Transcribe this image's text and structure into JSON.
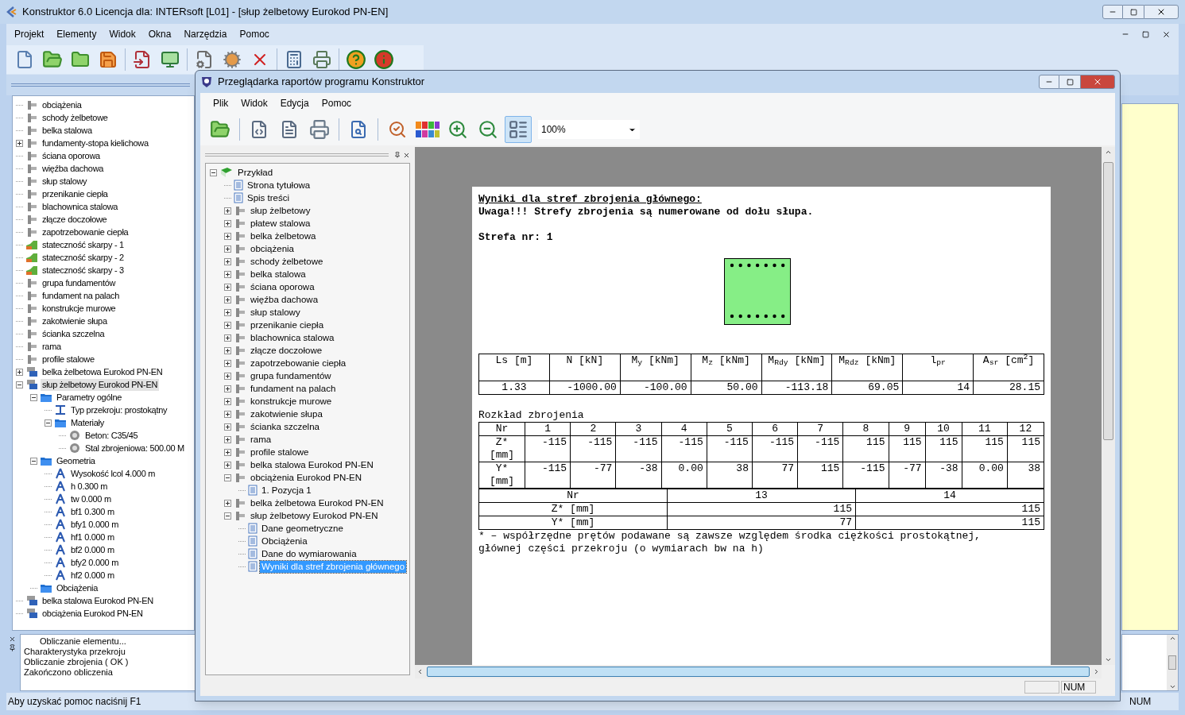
{
  "window": {
    "title": "Konstruktor 6.0 Licencja dla: INTERsoft [L01] - [słup żelbetowy Eurokod PN-EN]"
  },
  "menu": [
    "Projekt",
    "Elementy",
    "Widok",
    "Okna",
    "Narzędzia",
    "Pomoc"
  ],
  "element_tree": {
    "items": [
      {
        "label": "obciążenia",
        "kind": "element",
        "selected": false
      },
      {
        "label": "schody żelbetowe",
        "kind": "element",
        "selected": false
      },
      {
        "label": "belka stalowa",
        "kind": "element",
        "selected": false
      },
      {
        "label": "fundamenty-stopa kielichowa",
        "kind": "element",
        "selected": false,
        "expanded": false
      },
      {
        "label": "ściana oporowa",
        "kind": "element",
        "selected": false
      },
      {
        "label": "więźba dachowa",
        "kind": "element",
        "selected": false
      },
      {
        "label": "słup stalowy",
        "kind": "element",
        "selected": false
      },
      {
        "label": "przenikanie ciepła",
        "kind": "element",
        "selected": false
      },
      {
        "label": "blachownica stalowa",
        "kind": "element",
        "selected": false
      },
      {
        "label": "złącze doczołowe",
        "kind": "element",
        "selected": false
      },
      {
        "label": "zapotrzebowanie ciepła",
        "kind": "element",
        "selected": false
      },
      {
        "label": "stateczność skarpy - 1",
        "kind": "slope",
        "selected": false
      },
      {
        "label": "stateczność skarpy - 2",
        "kind": "slope",
        "selected": false
      },
      {
        "label": "stateczność skarpy - 3",
        "kind": "slope",
        "selected": false
      },
      {
        "label": "grupa fundamentów",
        "kind": "element",
        "selected": false
      },
      {
        "label": "fundament na palach",
        "kind": "element",
        "selected": false
      },
      {
        "label": "konstrukcje murowe",
        "kind": "element",
        "selected": false
      },
      {
        "label": "zakotwienie słupa",
        "kind": "element",
        "selected": false
      },
      {
        "label": "ścianka szczelna",
        "kind": "element",
        "selected": false
      },
      {
        "label": "rama",
        "kind": "element",
        "selected": false
      },
      {
        "label": "profile stalowe",
        "kind": "element",
        "selected": false
      },
      {
        "label": "belka żelbetowa Eurokod PN-EN",
        "kind": "eurocode",
        "selected": false,
        "expanded": false
      },
      {
        "label": "słup żelbetowy Eurokod PN-EN",
        "kind": "eurocode",
        "selected": true,
        "expanded": true,
        "children": [
          {
            "label": "Parametry ogólne",
            "kind": "folder",
            "selected": false,
            "expanded": true,
            "children": [
              {
                "label": "Typ przekroju: prostokątny",
                "kind": "section",
                "selected": false
              },
              {
                "label": "Materiały",
                "kind": "folder",
                "selected": false,
                "expanded": true,
                "children": [
                  {
                    "label": "Beton: C35/45",
                    "kind": "material",
                    "selected": false
                  },
                  {
                    "label": "Stal zbrojeniowa: 500.00 M",
                    "kind": "material",
                    "selected": false
                  }
                ]
              }
            ]
          },
          {
            "label": "Geometria",
            "kind": "folder",
            "selected": false,
            "expanded": true,
            "children": [
              {
                "label": "Wysokość lcol 4.000 m",
                "kind": "dimension",
                "selected": false
              },
              {
                "label": "h 0.300 m",
                "kind": "dimension",
                "selected": false
              },
              {
                "label": "tw 0.000 m",
                "kind": "dimension",
                "selected": false
              },
              {
                "label": "bf1 0.300 m",
                "kind": "dimension",
                "selected": false
              },
              {
                "label": "bfy1 0.000 m",
                "kind": "dimension",
                "selected": false
              },
              {
                "label": "hf1 0.000 m",
                "kind": "dimension",
                "selected": false
              },
              {
                "label": "bf2 0.000 m",
                "kind": "dimension",
                "selected": false
              },
              {
                "label": "bfy2 0.000 m",
                "kind": "dimension",
                "selected": false
              },
              {
                "label": "hf2 0.000 m",
                "kind": "dimension",
                "selected": false
              }
            ]
          },
          {
            "label": "Obciążenia",
            "kind": "folder",
            "selected": false
          }
        ]
      },
      {
        "label": "belka stalowa Eurokod PN-EN",
        "kind": "eurocode",
        "selected": false
      },
      {
        "label": "obciążenia Eurokod PN-EN",
        "kind": "eurocode",
        "selected": false
      }
    ]
  },
  "output": {
    "lines": [
      {
        "text": "Obliczanie elementu...",
        "kind": "title"
      },
      {
        "text": "Charakterystyka przekroju",
        "kind": "line"
      },
      {
        "text": "Obliczanie zbrojenia ( OK )",
        "kind": "line"
      },
      {
        "text": "Zakończono obliczenia",
        "kind": "line"
      }
    ]
  },
  "status_bar": {
    "message": "Aby uzyskać pomoc naciśnij F1",
    "indicator": "NUM"
  },
  "report_viewer": {
    "title": "Przeglądarka raportów programu Konstruktor",
    "menu": [
      "Plik",
      "Widok",
      "Edycja",
      "Pomoc"
    ],
    "toolbar": {
      "page_view": {
        "on": true
      },
      "zoom": "100%"
    },
    "tree": [
      {
        "label": "Przykład",
        "kind": "project",
        "selected": false,
        "expanded": true,
        "children": [
          {
            "label": "Strona tytułowa",
            "kind": "page",
            "selected": false
          },
          {
            "label": "Spis treści",
            "kind": "page",
            "selected": false
          },
          {
            "label": "słup żelbetowy",
            "kind": "element",
            "selected": false,
            "expanded": false
          },
          {
            "label": "płatew stalowa",
            "kind": "element",
            "selected": false,
            "expanded": false
          },
          {
            "label": "belka żelbetowa",
            "kind": "element",
            "selected": false,
            "expanded": false
          },
          {
            "label": "obciążenia",
            "kind": "element",
            "selected": false,
            "expanded": false
          },
          {
            "label": "schody żelbetowe",
            "kind": "element",
            "selected": false,
            "expanded": false
          },
          {
            "label": "belka stalowa",
            "kind": "element",
            "selected": false,
            "expanded": false
          },
          {
            "label": "ściana oporowa",
            "kind": "element",
            "selected": false,
            "expanded": false
          },
          {
            "label": "więźba dachowa",
            "kind": "element",
            "selected": false,
            "expanded": false
          },
          {
            "label": "słup stalowy",
            "kind": "element",
            "selected": false,
            "expanded": false
          },
          {
            "label": "przenikanie ciepła",
            "kind": "element",
            "selected": false,
            "expanded": false
          },
          {
            "label": "blachownica stalowa",
            "kind": "element",
            "selected": false,
            "expanded": false
          },
          {
            "label": "złącze doczołowe",
            "kind": "element",
            "selected": false,
            "expanded": false
          },
          {
            "label": "zapotrzebowanie ciepła",
            "kind": "element",
            "selected": false,
            "expanded": false
          },
          {
            "label": "grupa fundamentów",
            "kind": "element",
            "selected": false,
            "expanded": false
          },
          {
            "label": "fundament na palach",
            "kind": "element",
            "selected": false,
            "expanded": false
          },
          {
            "label": "konstrukcje murowe",
            "kind": "element",
            "selected": false,
            "expanded": false
          },
          {
            "label": "zakotwienie słupa",
            "kind": "element",
            "selected": false,
            "expanded": false
          },
          {
            "label": "ścianka szczelna",
            "kind": "element",
            "selected": false,
            "expanded": false
          },
          {
            "label": "rama",
            "kind": "element",
            "selected": false,
            "expanded": false
          },
          {
            "label": "profile stalowe",
            "kind": "element",
            "selected": false,
            "expanded": false
          },
          {
            "label": "belka stalowa Eurokod PN-EN",
            "kind": "element",
            "selected": false,
            "expanded": false
          },
          {
            "label": "obciążenia Eurokod PN-EN",
            "kind": "element",
            "selected": false,
            "expanded": true,
            "children": [
              {
                "label": "1. Pozycja 1",
                "kind": "page",
                "selected": false
              }
            ]
          },
          {
            "label": "belka żelbetowa Eurokod PN-EN",
            "kind": "element",
            "selected": false,
            "expanded": false
          },
          {
            "label": "słup żelbetowy Eurokod PN-EN",
            "kind": "element",
            "selected": false,
            "expanded": true,
            "children": [
              {
                "label": "Dane geometryczne",
                "kind": "page",
                "selected": false
              },
              {
                "label": "Obciążenia",
                "kind": "page",
                "selected": false
              },
              {
                "label": "Dane do wymiarowania",
                "kind": "page",
                "selected": false
              },
              {
                "label": "Wyniki dla stref zbrojenia głównego",
                "kind": "page",
                "selected": true
              }
            ]
          }
        ]
      }
    ],
    "report": {
      "heading": "Wyniki dla stref zbrojenia głównego:",
      "note": "Uwaga!!! Strefy zbrojenia są numerowane od dołu słupa.",
      "zone": "Strefa nr: 1",
      "results_table": {
        "columns": [
          "Ls [m]",
          "N [kN]",
          "M$_{y}$ [kNm]",
          "M$_{z}$ [kNm]",
          "M$_{Rdy}$ [kNm]",
          "M$_{Rdz}$ [kNm]",
          "l$_{pr}$",
          "A$_{sr}$ [cm$^{2}$]"
        ],
        "rows": [
          [
            "1.33",
            "-1000.00",
            "-100.00",
            "50.00",
            "-113.18",
            "69.05",
            "14",
            "28.15"
          ]
        ]
      },
      "distribution_title": "Rozkład zbrojenia",
      "distribution_table": {
        "columns": [
          "Nr",
          "1",
          "2",
          "3",
          "4",
          "5",
          "6",
          "7",
          "8",
          "9",
          "10",
          "11",
          "12"
        ],
        "rows": [
          {
            "label": "Z* [mm]",
            "values": [
              "-115",
              "-115",
              "-115",
              "-115",
              "-115",
              "-115",
              "-115",
              "115",
              "115",
              "115",
              "115",
              "115"
            ]
          },
          {
            "label": "Y* [mm]",
            "values": [
              "-115",
              "-77",
              "-38",
              "0.00",
              "38",
              "77",
              "115",
              "-115",
              "-77",
              "-38",
              "0.00",
              "38"
            ]
          }
        ]
      },
      "distribution_table_2": {
        "columns": [
          "Nr",
          "13",
          "14"
        ],
        "rows": [
          {
            "label": "Z* [mm]",
            "values": [
              "115",
              "115"
            ]
          },
          {
            "label": "Y* [mm]",
            "values": [
              "77",
              "115"
            ]
          }
        ]
      },
      "footnote": "* – współrzędne prętów podawane są zawsze względem środka ciężkości prostokątnej, głównej części przekroju (o wymiarach bw na h)"
    },
    "status_bar": {
      "indicator": "NUM"
    }
  }
}
